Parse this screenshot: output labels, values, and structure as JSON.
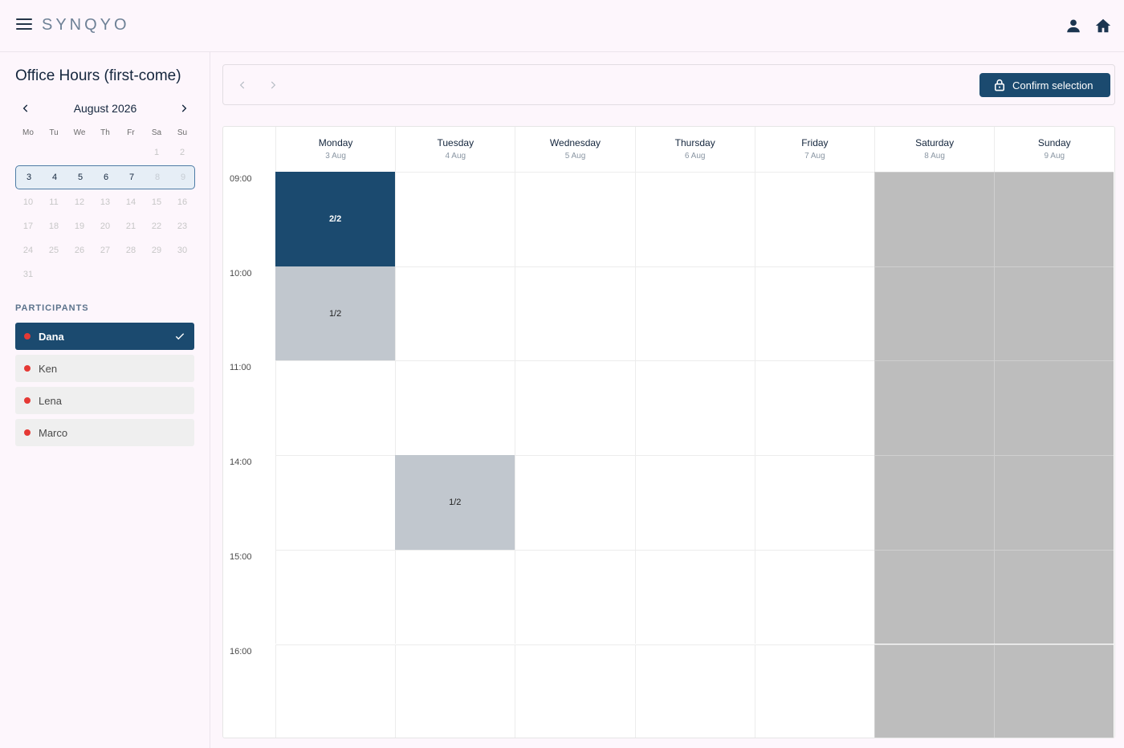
{
  "app": {
    "brand": "SYNQYO"
  },
  "page": {
    "title": "Office Hours (first-come)"
  },
  "mini_calendar": {
    "month_label": "August 2026",
    "days_of_week": [
      "Mo",
      "Tu",
      "We",
      "Th",
      "Fr",
      "Sa",
      "Su"
    ],
    "weeks": [
      [
        "",
        "",
        "",
        "",
        "",
        "1",
        "2"
      ],
      [
        "3",
        "4",
        "5",
        "6",
        "7",
        "8",
        "9"
      ],
      [
        "10",
        "11",
        "12",
        "13",
        "14",
        "15",
        "16"
      ],
      [
        "17",
        "18",
        "19",
        "20",
        "21",
        "22",
        "23"
      ],
      [
        "24",
        "25",
        "26",
        "27",
        "28",
        "29",
        "30"
      ],
      [
        "31",
        "",
        "",
        "",
        "",
        "",
        ""
      ]
    ],
    "selected_week_index": 1
  },
  "participants": {
    "label": "PARTICIPANTS",
    "items": [
      {
        "name": "Dana",
        "active": true
      },
      {
        "name": "Ken",
        "active": false
      },
      {
        "name": "Lena",
        "active": false
      },
      {
        "name": "Marco",
        "active": false
      }
    ]
  },
  "toolbar": {
    "confirm_label": "Confirm selection"
  },
  "week": {
    "days": [
      {
        "name": "Monday",
        "date": "3 Aug",
        "weekend": false
      },
      {
        "name": "Tuesday",
        "date": "4 Aug",
        "weekend": false
      },
      {
        "name": "Wednesday",
        "date": "5 Aug",
        "weekend": false
      },
      {
        "name": "Thursday",
        "date": "6 Aug",
        "weekend": false
      },
      {
        "name": "Friday",
        "date": "7 Aug",
        "weekend": false
      },
      {
        "name": "Saturday",
        "date": "8 Aug",
        "weekend": true
      },
      {
        "name": "Sunday",
        "date": "9 Aug",
        "weekend": true
      }
    ],
    "times": [
      "09:00",
      "10:00",
      "11:00",
      "14:00",
      "15:00",
      "16:00"
    ],
    "slots": [
      {
        "day": 0,
        "time": 0,
        "label": "2/2",
        "state": "full"
      },
      {
        "day": 0,
        "time": 1,
        "label": "1/2",
        "state": "partial"
      },
      {
        "day": 1,
        "time": 3,
        "label": "1/2",
        "state": "partial"
      }
    ]
  },
  "colors": {
    "primary": "#1b4a6f",
    "participant_dot": "#e53935",
    "weekend": "#bdbdbd",
    "partial_slot": "#c1c7ce"
  },
  "icons": {
    "menu": "menu-icon",
    "profile": "person-icon",
    "home": "home-icon",
    "prev": "chevron-left-icon",
    "next": "chevron-right-icon",
    "lock": "lock-icon",
    "check": "check-icon"
  }
}
